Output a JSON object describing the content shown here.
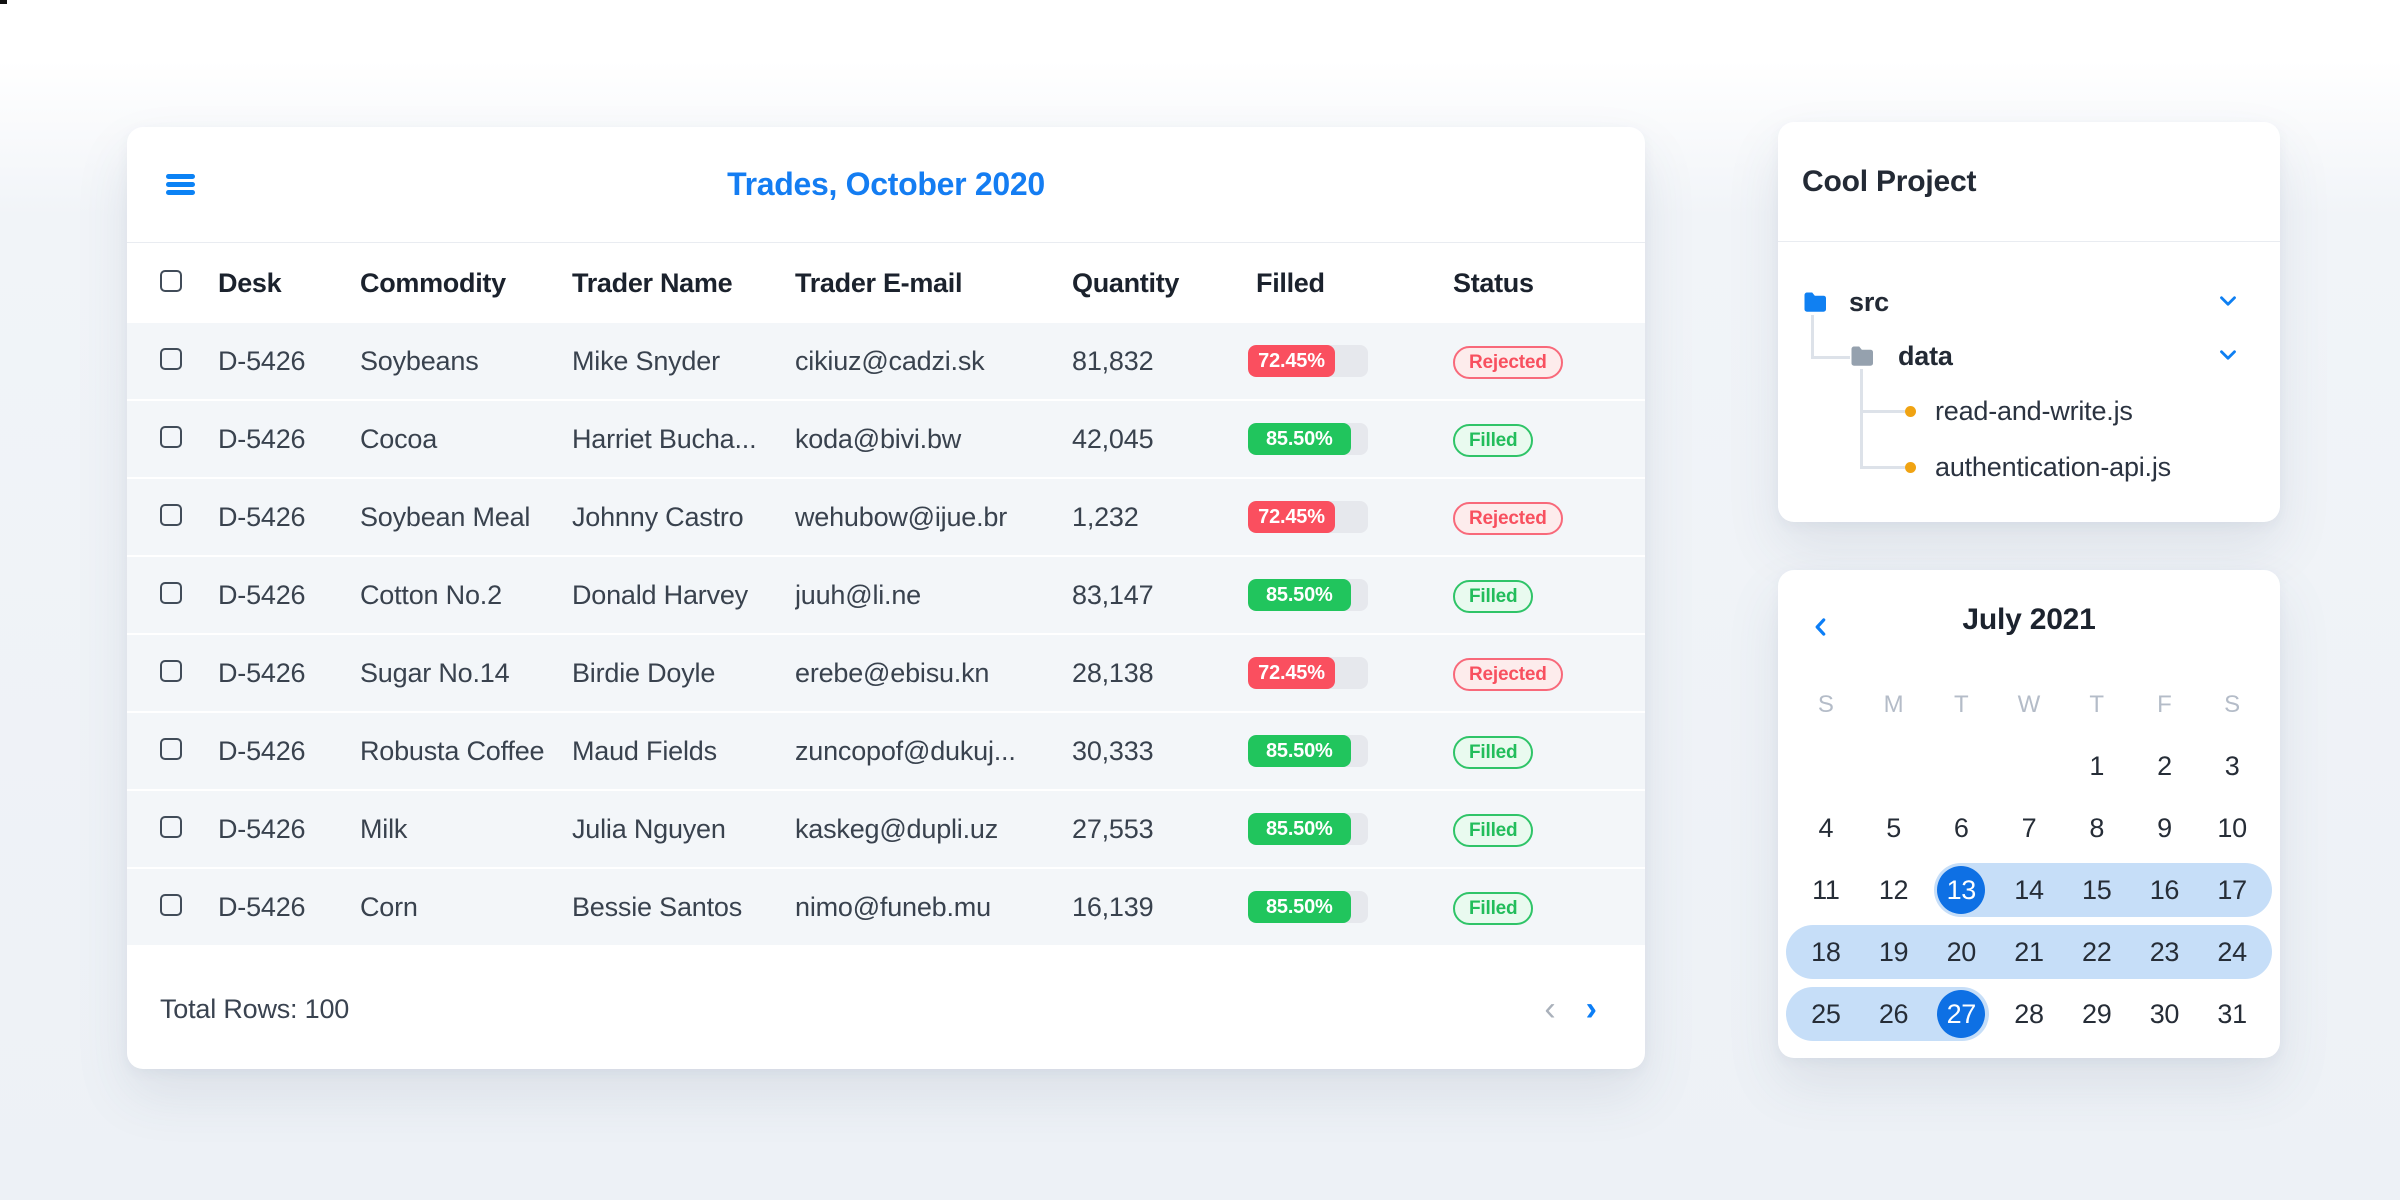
{
  "icons": {
    "menu": "hamburger-menu",
    "pager_prev": "chevron-left",
    "pager_next": "chevron-right",
    "tree_collapse": "chevron-down",
    "calendar_prev": "chevron-left",
    "folder": "folder",
    "file_bullet": "orange-dot"
  },
  "colors": {
    "accent_blue": "#147df2",
    "danger_red": "#fa4f5f",
    "success_green": "#21c55d",
    "bar_track": "#e6e8ed",
    "calendar_selected": "#0e70e4",
    "calendar_range_band": "#c6def8",
    "folder_blue": "#1080f2",
    "folder_gray": "#95a1ae",
    "file_dot_orange": "#f0a312"
  },
  "trades": {
    "title": "Trades, October 2020",
    "columns": {
      "desk": "Desk",
      "commodity": "Commodity",
      "trader_name": "Trader Name",
      "trader_email": "Trader E-mail",
      "quantity": "Quantity",
      "filled": "Filled",
      "status": "Status"
    },
    "rows": [
      {
        "desk": "D-5426",
        "commodity": "Soybeans",
        "trader_name": "Mike Snyder",
        "trader_email": "cikiuz@cadzi.sk",
        "quantity": "81,832",
        "filled_pct": "72.45%",
        "status": "Rejected",
        "variant": "danger"
      },
      {
        "desk": "D-5426",
        "commodity": "Cocoa",
        "trader_name": "Harriet Bucha...",
        "trader_email": "koda@bivi.bw",
        "quantity": "42,045",
        "filled_pct": "85.50%",
        "status": "Filled",
        "variant": "success"
      },
      {
        "desk": "D-5426",
        "commodity": "Soybean Meal",
        "trader_name": "Johnny Castro",
        "trader_email": "wehubow@ijue.br",
        "quantity": "1,232",
        "filled_pct": "72.45%",
        "status": "Rejected",
        "variant": "danger"
      },
      {
        "desk": "D-5426",
        "commodity": "Cotton No.2",
        "trader_name": "Donald Harvey",
        "trader_email": "juuh@li.ne",
        "quantity": "83,147",
        "filled_pct": "85.50%",
        "status": "Filled",
        "variant": "success"
      },
      {
        "desk": "D-5426",
        "commodity": "Sugar No.14",
        "trader_name": "Birdie Doyle",
        "trader_email": "erebe@ebisu.kn",
        "quantity": "28,138",
        "filled_pct": "72.45%",
        "status": "Rejected",
        "variant": "danger"
      },
      {
        "desk": "D-5426",
        "commodity": "Robusta Coffee",
        "trader_name": "Maud Fields",
        "trader_email": "zuncopof@dukuj...",
        "quantity": "30,333",
        "filled_pct": "85.50%",
        "status": "Filled",
        "variant": "success"
      },
      {
        "desk": "D-5426",
        "commodity": "Milk",
        "trader_name": "Julia Nguyen",
        "trader_email": "kaskeg@dupli.uz",
        "quantity": "27,553",
        "filled_pct": "85.50%",
        "status": "Filled",
        "variant": "success"
      },
      {
        "desk": "D-5426",
        "commodity": "Corn",
        "trader_name": "Bessie Santos",
        "trader_email": "nimo@funeb.mu",
        "quantity": "16,139",
        "filled_pct": "85.50%",
        "status": "Filled",
        "variant": "success"
      }
    ],
    "footer": {
      "total": "Total Rows: 100",
      "prev": "‹",
      "next": "›"
    }
  },
  "project": {
    "title": "Cool Project",
    "tree": {
      "src": "src",
      "data": "data",
      "files": [
        "read-and-write.js",
        "authentication-api.js"
      ]
    }
  },
  "calendar": {
    "title": "July 2021",
    "weekdays": [
      "S",
      "M",
      "T",
      "W",
      "T",
      "F",
      "S"
    ],
    "weeks": [
      [
        "",
        "",
        "",
        "",
        "1",
        "2",
        "3"
      ],
      [
        "4",
        "5",
        "6",
        "7",
        "8",
        "9",
        "10"
      ],
      [
        "11",
        "12",
        "13",
        "14",
        "15",
        "16",
        "17"
      ],
      [
        "18",
        "19",
        "20",
        "21",
        "22",
        "23",
        "24"
      ],
      [
        "25",
        "26",
        "27",
        "28",
        "29",
        "30",
        "31"
      ]
    ],
    "selected_days": [
      "13",
      "27"
    ],
    "range": {
      "start": "13",
      "end": "27"
    }
  }
}
